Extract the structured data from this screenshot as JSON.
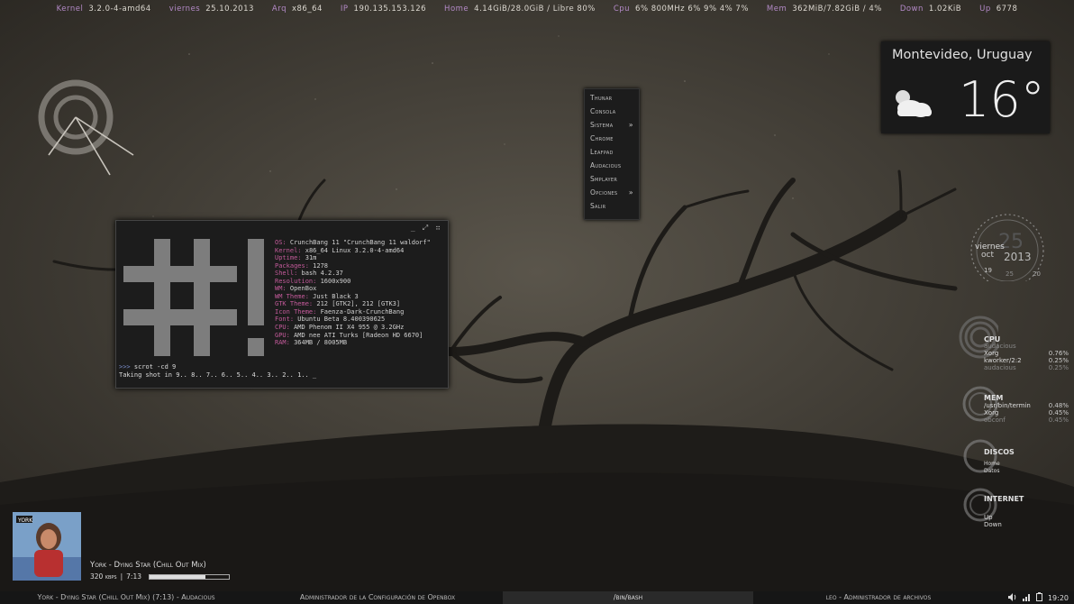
{
  "topbar": [
    {
      "k": "Kernel",
      "v": "3.2.0-4-amd64"
    },
    {
      "k": "viernes",
      "v": "25.10.2013"
    },
    {
      "k": "Arq",
      "v": "x86_64"
    },
    {
      "k": "IP",
      "v": "190.135.153.126"
    },
    {
      "k": "Home",
      "v": "4.14GiB/28.0GiB / Libre 80%"
    },
    {
      "k": "Cpu",
      "v": "6%  800MHz 6% 9% 4% 7%"
    },
    {
      "k": "Mem",
      "v": "362MiB/7.82GiB / 4%"
    },
    {
      "k": "Down",
      "v": "1.02KiB"
    },
    {
      "k": "Up",
      "v": "6778"
    }
  ],
  "menu": {
    "items": [
      {
        "label": "Thunar",
        "arrow": ""
      },
      {
        "label": "Consola",
        "arrow": ""
      },
      {
        "label": "Sistema",
        "arrow": "»"
      },
      {
        "label": "Chrome",
        "arrow": ""
      },
      {
        "label": "Leafpad",
        "arrow": ""
      },
      {
        "label": "Audacious",
        "arrow": ""
      },
      {
        "label": "Smplayer",
        "arrow": ""
      },
      {
        "label": "Opciones",
        "arrow": "»"
      },
      {
        "label": "Salir",
        "arrow": ""
      }
    ]
  },
  "weather": {
    "city": "Montevideo, Uruguay",
    "temp": "16°",
    "icon": "cloudy-sun-icon"
  },
  "terminal": {
    "controls": [
      "_",
      "⤢",
      "⠶"
    ],
    "logo": "#!",
    "info": [
      {
        "k": "OS:",
        "v": " CrunchBang 11 \"CrunchBang 11 waldorf\""
      },
      {
        "k": "Kernel:",
        "v": " x86_64 Linux 3.2.0-4-amd64"
      },
      {
        "k": "Uptime:",
        "v": " 31m"
      },
      {
        "k": "Packages:",
        "v": " 1278"
      },
      {
        "k": "Shell:",
        "v": " bash 4.2.37"
      },
      {
        "k": "Resolution:",
        "v": " 1600x900"
      },
      {
        "k": "WM:",
        "v": " OpenBox"
      },
      {
        "k": "WM Theme:",
        "v": " Just Black 3"
      },
      {
        "k": "GTK Theme:",
        "v": " 212 [GTK2], 212 [GTK3]"
      },
      {
        "k": "Icon Theme:",
        "v": " Faenza-Dark-CrunchBang"
      },
      {
        "k": "Font:",
        "v": " Ubuntu Beta 8.400390625"
      },
      {
        "k": "CPU:",
        "v": " AMD Phenom II X4 955 @ 3.2GHz"
      },
      {
        "k": "GPU:",
        "v": " AMD nee ATI Turks [Radeon HD 6670]"
      },
      {
        "k": "RAM:",
        "v": " 364MB / 8005MB"
      }
    ],
    "prompt_symbol": ">>>",
    "command": " scrot -cd 9",
    "output": "Taking shot in 9.. 8.. 7.. 6.. 5.. 4.. 3.. 2.. 1.. _"
  },
  "clock": {
    "bignum": "25",
    "day": "viernes",
    "month": "oct",
    "year": "2013",
    "n1": "19",
    "n2": "25",
    "n3": "20"
  },
  "cpu": {
    "title": "CPU",
    "rows": [
      {
        "n": "audacious",
        "p": "",
        "dim": true
      },
      {
        "n": "Xorg",
        "p": "0.76%",
        "dim": false
      },
      {
        "n": "kworker/2:2",
        "p": "0.25%",
        "dim": false
      },
      {
        "n": "audacious",
        "p": "0.25%",
        "dim": true
      }
    ]
  },
  "mem": {
    "title": "MEM",
    "rows": [
      {
        "n": "/usr/bin/termin",
        "p": "0.48%",
        "dim": false
      },
      {
        "n": "Xorg",
        "p": "0.45%",
        "dim": false
      },
      {
        "n": "obconf",
        "p": "0.45%",
        "dim": true
      }
    ]
  },
  "discos": {
    "title": "DISCOS",
    "rows": [
      {
        "n": "Home",
        "p": "",
        "dim": false
      },
      {
        "n": "Datos",
        "p": "",
        "dim": false
      }
    ]
  },
  "internet": {
    "title": "INTERNET",
    "rows": [
      {
        "n": "Up",
        "p": "",
        "dim": false
      },
      {
        "n": "Down",
        "p": "",
        "dim": false
      }
    ]
  },
  "player": {
    "title": "York - Dying Star (Chill Out Mix)",
    "bitrate": "320 kbps",
    "sep": "|",
    "time": "7:13",
    "progress": 0.7,
    "album_label": "YORK"
  },
  "taskbar": [
    {
      "label": "York - Dying Star (Chill Out Mix) (7:13) - Audacious",
      "active": false
    },
    {
      "label": "Administrador de la Configuración de Openbox",
      "active": false
    },
    {
      "label": "/bin/bash",
      "active": true
    },
    {
      "label": "leo - Administrador de archivos",
      "active": false
    }
  ],
  "tray": {
    "time": "19:20",
    "icons": [
      "volume-icon",
      "network-icon",
      "battery-icon"
    ]
  }
}
